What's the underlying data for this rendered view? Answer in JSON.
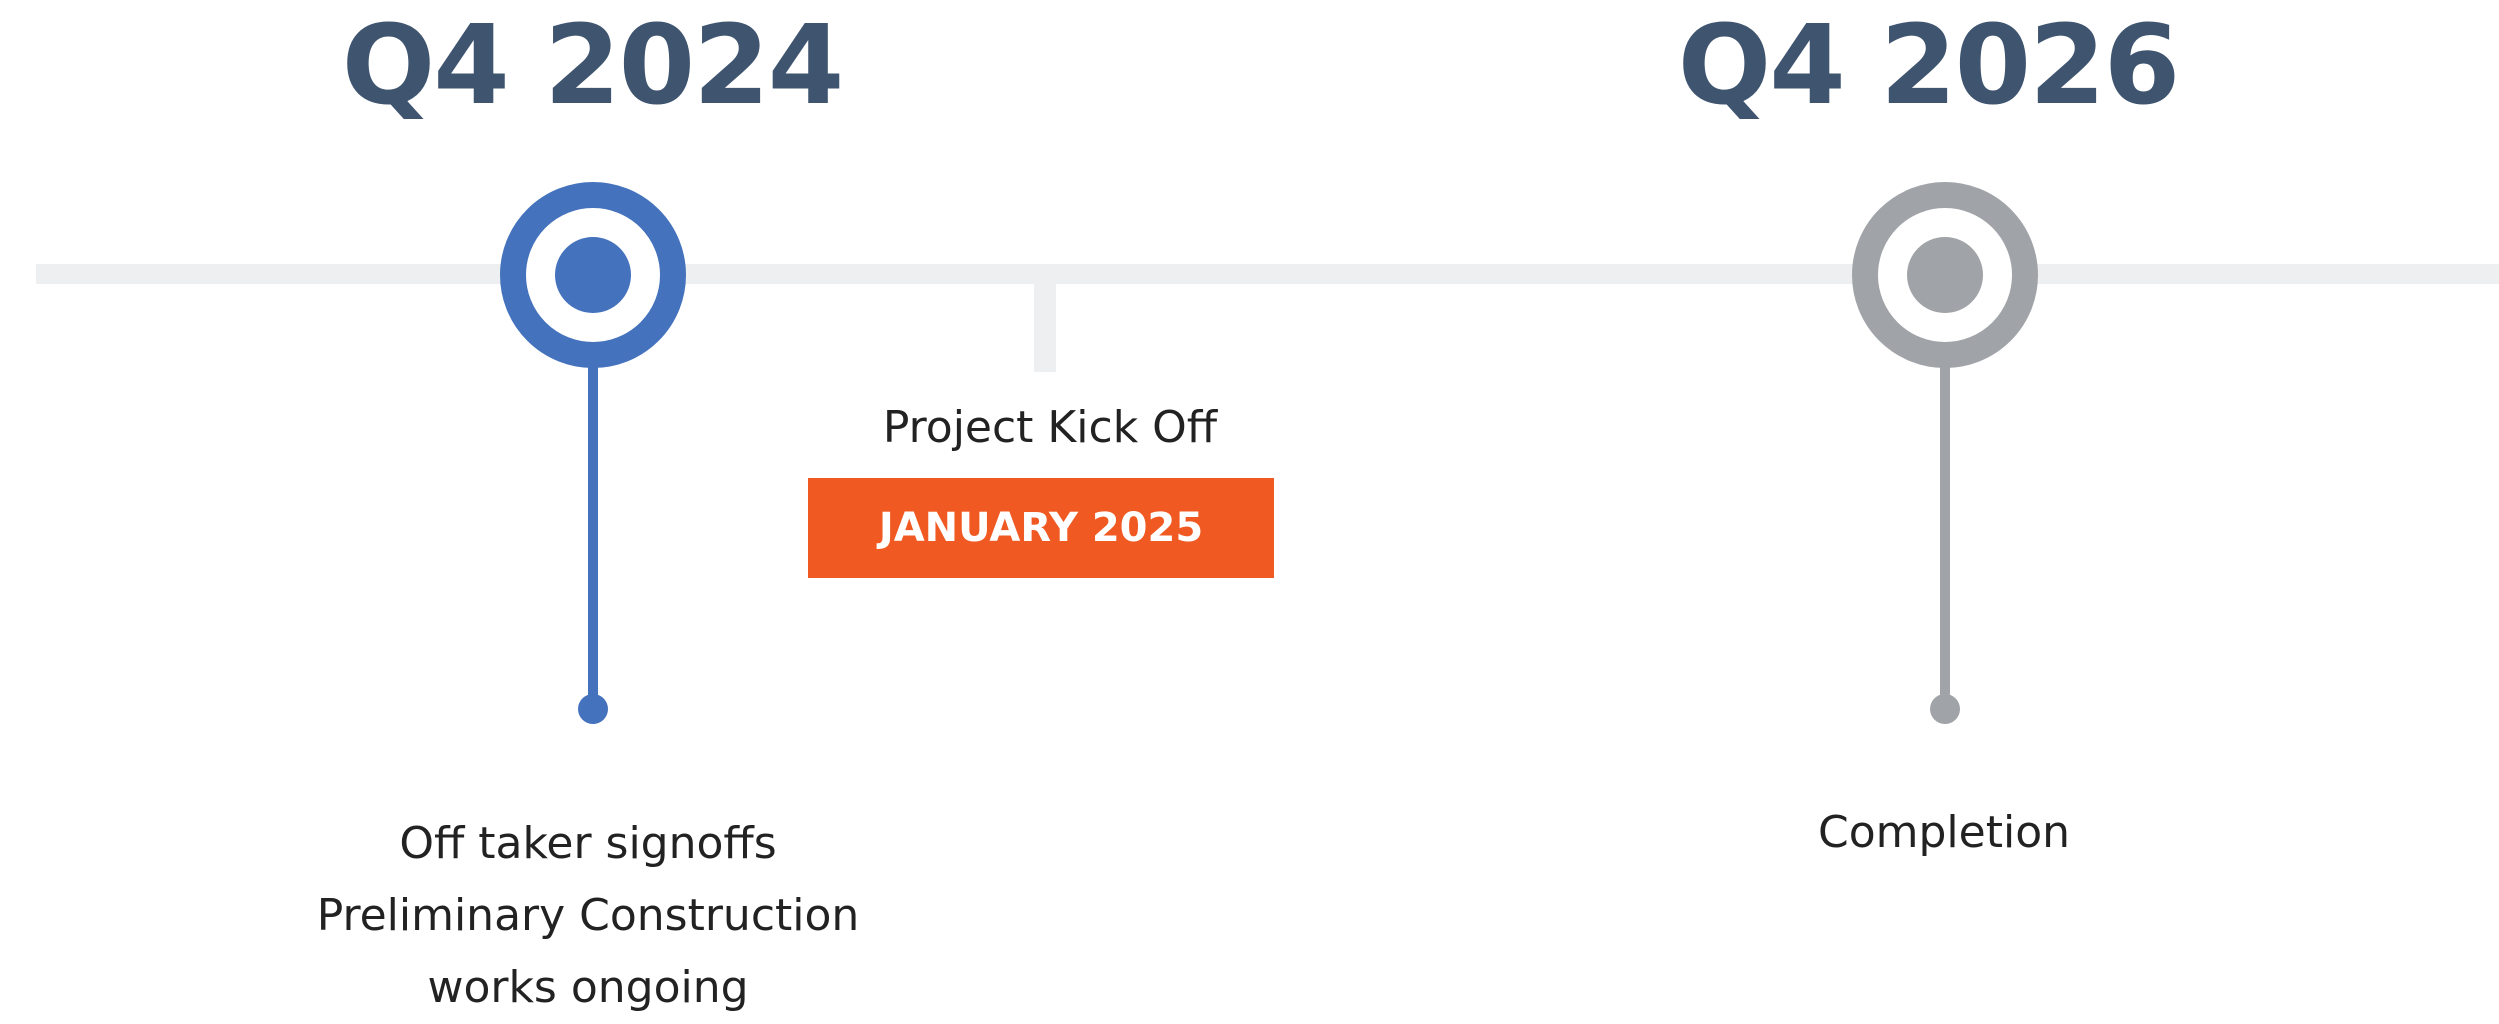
{
  "timeline": {
    "milestones": [
      {
        "period": "Q4 2024",
        "status_color": "#4472BD",
        "lines": [
          "Off taker signoffs",
          "Preliminary Construction",
          "works ongoing"
        ]
      },
      {
        "period": "Q4 2026",
        "status_color": "#A0A3A7",
        "lines": [
          "Completion"
        ]
      }
    ],
    "event": {
      "label": "Project Kick Off",
      "date": "JANUARY 2025",
      "badge_color": "#F05A22"
    },
    "axis_color": "#EEEFF1",
    "heading_color": "#3F546F"
  }
}
